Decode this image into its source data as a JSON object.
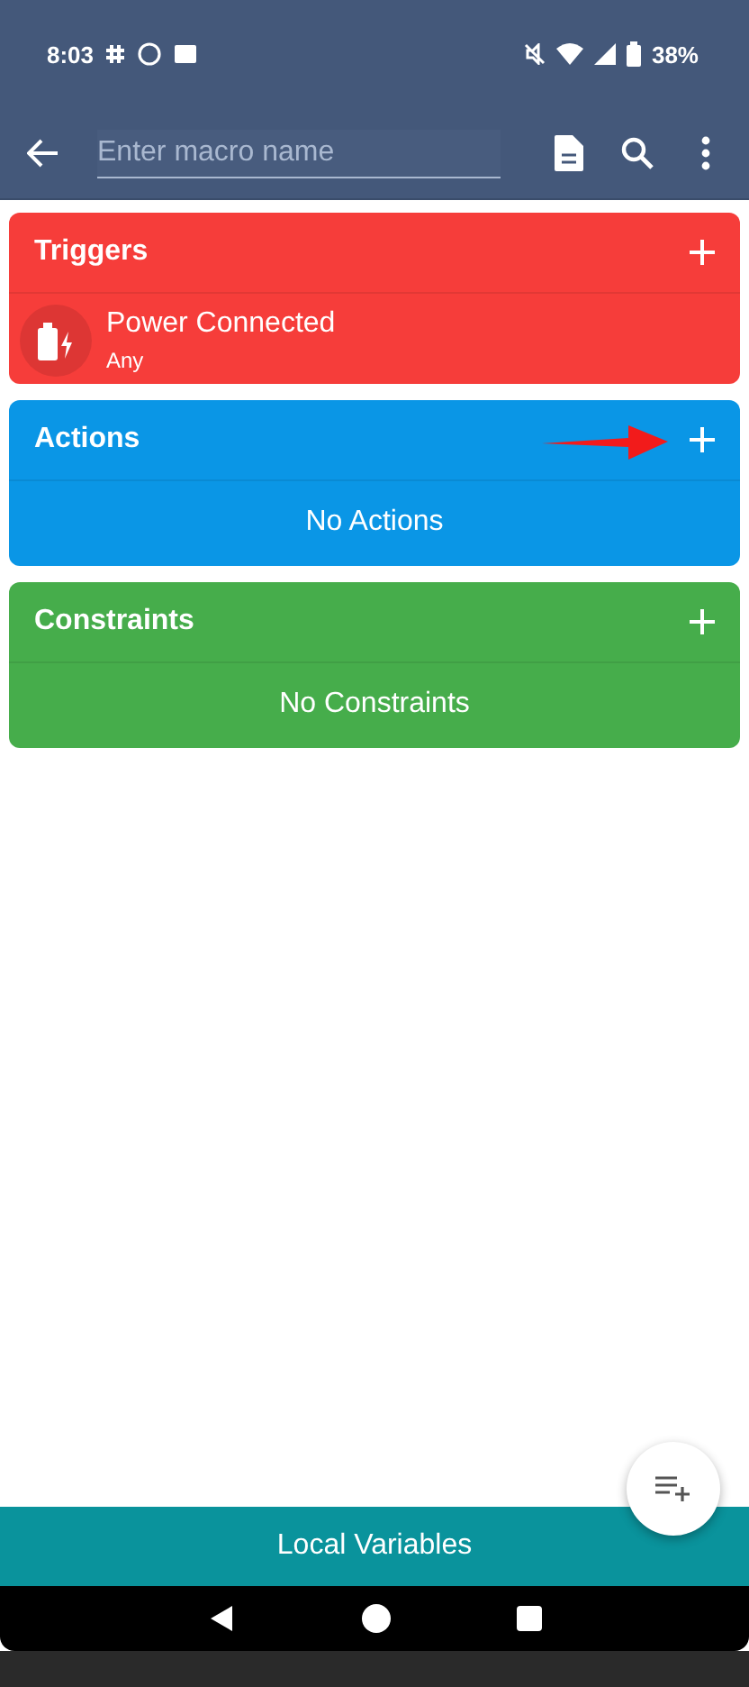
{
  "status_bar": {
    "time": "8:03",
    "battery": "38%"
  },
  "toolbar": {
    "macro_name": {
      "placeholder": "Enter macro name"
    }
  },
  "sections": [
    {
      "title": "Triggers",
      "color": "#f63d3a",
      "items": [
        {
          "title": "Power Connected",
          "subtitle": "Any"
        }
      ],
      "pointed": false
    },
    {
      "title": "Actions",
      "color": "#0a96e6",
      "empty_text": "No Actions",
      "pointed": true
    },
    {
      "title": "Constraints",
      "color": "#46ad4b",
      "empty_text": "No Constraints",
      "pointed": false
    }
  ],
  "bottom_bar": {
    "label": "Local Variables"
  }
}
